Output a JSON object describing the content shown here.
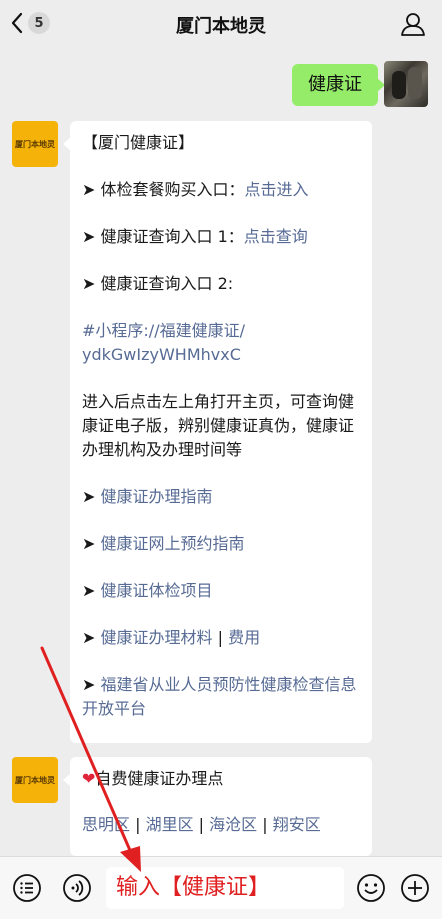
{
  "header": {
    "back_count": "5",
    "title": "厦门本地灵"
  },
  "sent": {
    "text": "健康证"
  },
  "bot": {
    "avatar_text": "厦门本地灵",
    "msg1": {
      "heading": "【厦门健康证】",
      "buy_label": "➤ 体检套餐购买入口：",
      "buy_link": "点击进入",
      "query1_label": "➤ 健康证查询入口 1：",
      "query1_link": "点击查询",
      "query2_label": "➤ 健康证查询入口 2:",
      "miniprogram_line1": "#小程序://福建健康证/",
      "miniprogram_line2": "ydkGwIzyWHMhvxC",
      "desc": "进入后点击左上角打开主页，可查询健康证电子版，辨别健康证真伪，健康证办理机构及办理时间等",
      "arrow": "➤ ",
      "guide": "健康证办理指南",
      "appointment": "健康证网上预约指南",
      "exam_items": "健康证体检项目",
      "materials": "健康证办理材料",
      "sep": " | ",
      "fee": "费用",
      "platform": "福建省从业人员预防性健康检查信息开放平台"
    },
    "msg2": {
      "heading": "自费健康证办理点",
      "heart": "❤",
      "districts": [
        "思明区",
        "湖里区",
        "海沧区",
        "翔安区"
      ],
      "sep": " | "
    }
  },
  "input": {
    "value": "输入【健康证】"
  },
  "colors": {
    "link": "#576b95",
    "green_bubble": "#95ec69",
    "annotation": "#e02020"
  }
}
